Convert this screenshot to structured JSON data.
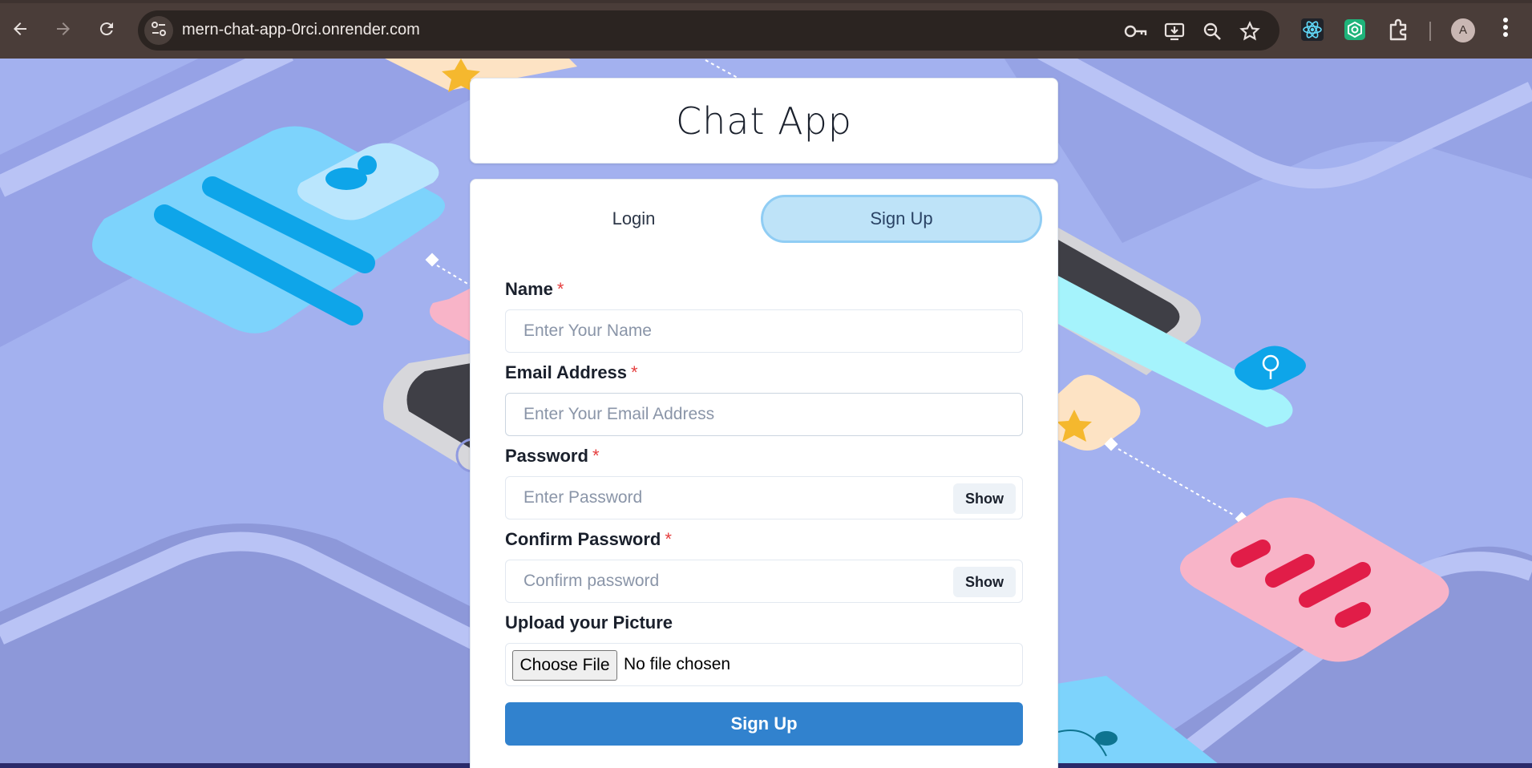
{
  "browser": {
    "url": "mern-chat-app-0rci.onrender.com",
    "profile_initial": "A",
    "nav": {
      "back_icon": "arrow-left-icon",
      "forward_icon": "arrow-right-icon",
      "reload_icon": "reload-icon"
    },
    "omnibox_icons": [
      "password-key-icon",
      "install-app-icon",
      "zoom-icon",
      "bookmark-star-icon"
    ],
    "extension_icons": [
      "react-devtools-icon",
      "green-extension-icon",
      "extensions-puzzle-icon"
    ]
  },
  "app": {
    "title": "Chat App"
  },
  "tabs": {
    "login": "Login",
    "signup": "Sign Up",
    "active": "signup"
  },
  "form": {
    "name": {
      "label": "Name",
      "required_mark": "*",
      "placeholder": "Enter Your Name",
      "value": ""
    },
    "email": {
      "label": "Email Address",
      "required_mark": "*",
      "placeholder": "Enter Your Email Address",
      "value": ""
    },
    "password": {
      "label": "Password",
      "required_mark": "*",
      "placeholder": "Enter Password",
      "value": "",
      "toggle_label": "Show"
    },
    "confirm_password": {
      "label": "Confirm Password",
      "required_mark": "*",
      "placeholder": "Confirm password",
      "value": "",
      "toggle_label": "Show"
    },
    "picture": {
      "label": "Upload your Picture",
      "button_label": "Choose File",
      "status": "No file chosen"
    },
    "submit_label": "Sign Up"
  },
  "colors": {
    "chrome_bar": "#4a3d39",
    "omnibox": "#2b2421",
    "page_background": "#a3b1ef",
    "tab_active_bg": "#bee3f8",
    "primary_button": "#3182ce",
    "required_asterisk": "#e53e3e"
  }
}
